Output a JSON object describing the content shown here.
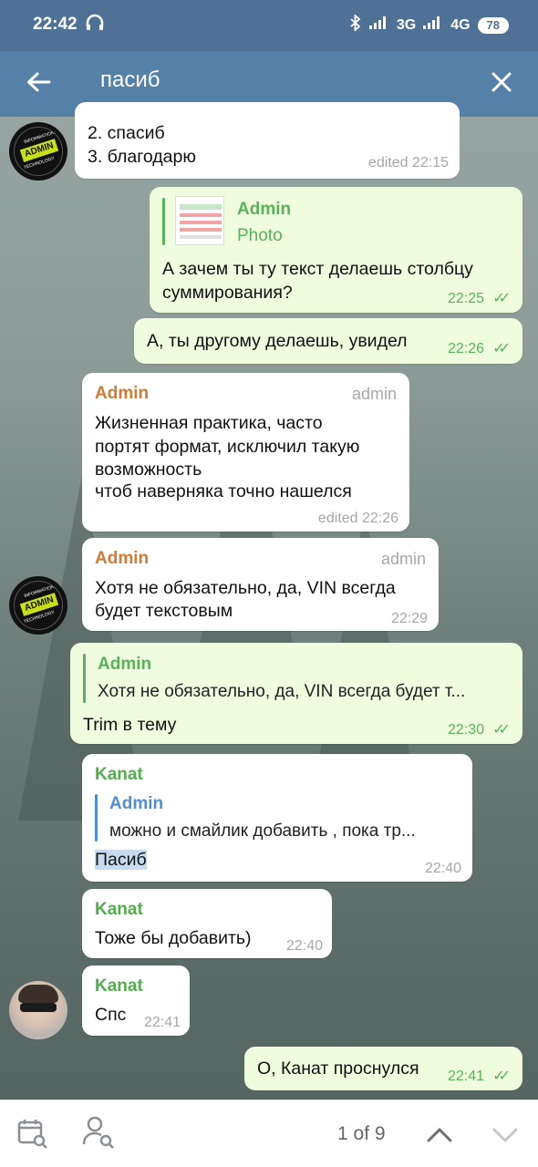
{
  "status_bar": {
    "time": "22:42",
    "network_1": "3G",
    "network_2": "4G",
    "battery": "78"
  },
  "search_bar": {
    "query": "пасиб"
  },
  "messages": [
    {
      "id": "m1",
      "direction": "in",
      "lines": [
        "2. спасиб",
        "3. благодарю"
      ],
      "time": "edited 22:15"
    },
    {
      "id": "m2",
      "direction": "out",
      "reply_to": {
        "name": "Admin",
        "text": "Photo"
      },
      "lines": [
        "А зачем ты ту текст делаешь столбцу",
        "суммирования?"
      ],
      "time": "22:25"
    },
    {
      "id": "m3",
      "direction": "out",
      "lines": [
        "А, ты другому делаешь, увидел"
      ],
      "time": "22:26"
    },
    {
      "id": "m4",
      "direction": "in",
      "sender": "Admin",
      "role": "admin",
      "lines": [
        "Жизненная практика, часто",
        "портят формат, исключил такую",
        "возможность",
        "чтоб наверняка точно нашелся"
      ],
      "time": "edited 22:26"
    },
    {
      "id": "m5",
      "direction": "in",
      "sender": "Admin",
      "role": "admin",
      "lines": [
        "Хотя не обязательно, да, VIN всегда",
        "будет текстовым"
      ],
      "time": "22:29"
    },
    {
      "id": "m6",
      "direction": "out",
      "reply_to": {
        "name": "Admin",
        "text": "Хотя не обязательно, да, VIN всегда будет т..."
      },
      "lines": [
        "Trim в тему"
      ],
      "time": "22:30"
    },
    {
      "id": "m7",
      "direction": "in",
      "sender": "Kanat",
      "reply_to": {
        "name": "Admin",
        "text": "можно и смайлик добавить , пока тр..."
      },
      "lines": [
        "Пасиб"
      ],
      "time": "22:40"
    },
    {
      "id": "m8",
      "direction": "in",
      "sender": "Kanat",
      "lines": [
        "Тоже бы добавить)"
      ],
      "time": "22:40"
    },
    {
      "id": "m9",
      "direction": "in",
      "sender": "Kanat",
      "lines": [
        "Спс"
      ],
      "time": "22:41"
    },
    {
      "id": "m10",
      "direction": "out",
      "lines": [
        "О, Канат проснулся"
      ],
      "time": "22:41"
    }
  ],
  "avatars": {
    "admin_logo_top": "INFORMATION",
    "admin_logo_main": "ADMIN",
    "admin_logo_bottom": "TECHNOLOGY"
  },
  "bottom_bar": {
    "counter": "1 of 9"
  },
  "colors": {
    "status_bar": "#4f7196",
    "app_bar": "#5580a8",
    "outgoing_bubble": "#effdde",
    "incoming_bubble": "#ffffff",
    "admin_name": "#d07a36",
    "kanat_name": "#52ae4a",
    "reply_bar_blue": "#4f8fd0"
  }
}
